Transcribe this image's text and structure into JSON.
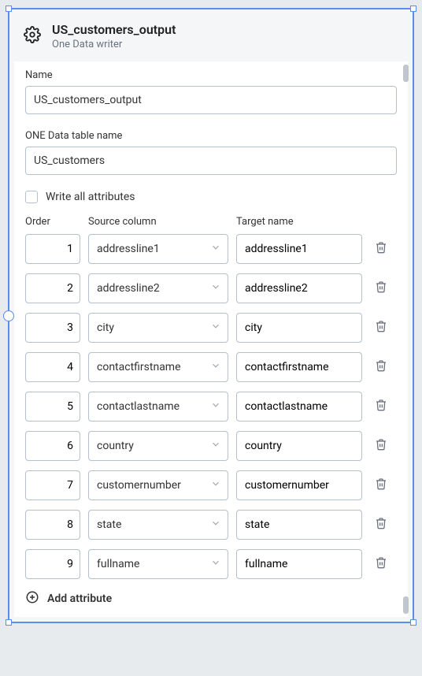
{
  "header": {
    "title": "US_customers_output",
    "subtitle": "One Data writer"
  },
  "form": {
    "name_label": "Name",
    "name_value": "US_customers_output",
    "table_label": "ONE Data table name",
    "table_value": "US_customers",
    "write_all_label": "Write all attributes",
    "columns": {
      "order": "Order",
      "source": "Source column",
      "target": "Target name"
    }
  },
  "rows": [
    {
      "order": "1",
      "source": "addressline1",
      "target": "addressline1"
    },
    {
      "order": "2",
      "source": "addressline2",
      "target": "addressline2"
    },
    {
      "order": "3",
      "source": "city",
      "target": "city"
    },
    {
      "order": "4",
      "source": "contactfirstname",
      "target": "contactfirstname"
    },
    {
      "order": "5",
      "source": "contactlastname",
      "target": "contactlastname"
    },
    {
      "order": "6",
      "source": "country",
      "target": "country"
    },
    {
      "order": "7",
      "source": "customernumber",
      "target": "customernumber"
    },
    {
      "order": "8",
      "source": "state",
      "target": "state"
    },
    {
      "order": "9",
      "source": "fullname",
      "target": "fullname"
    }
  ],
  "add_label": "Add attribute"
}
